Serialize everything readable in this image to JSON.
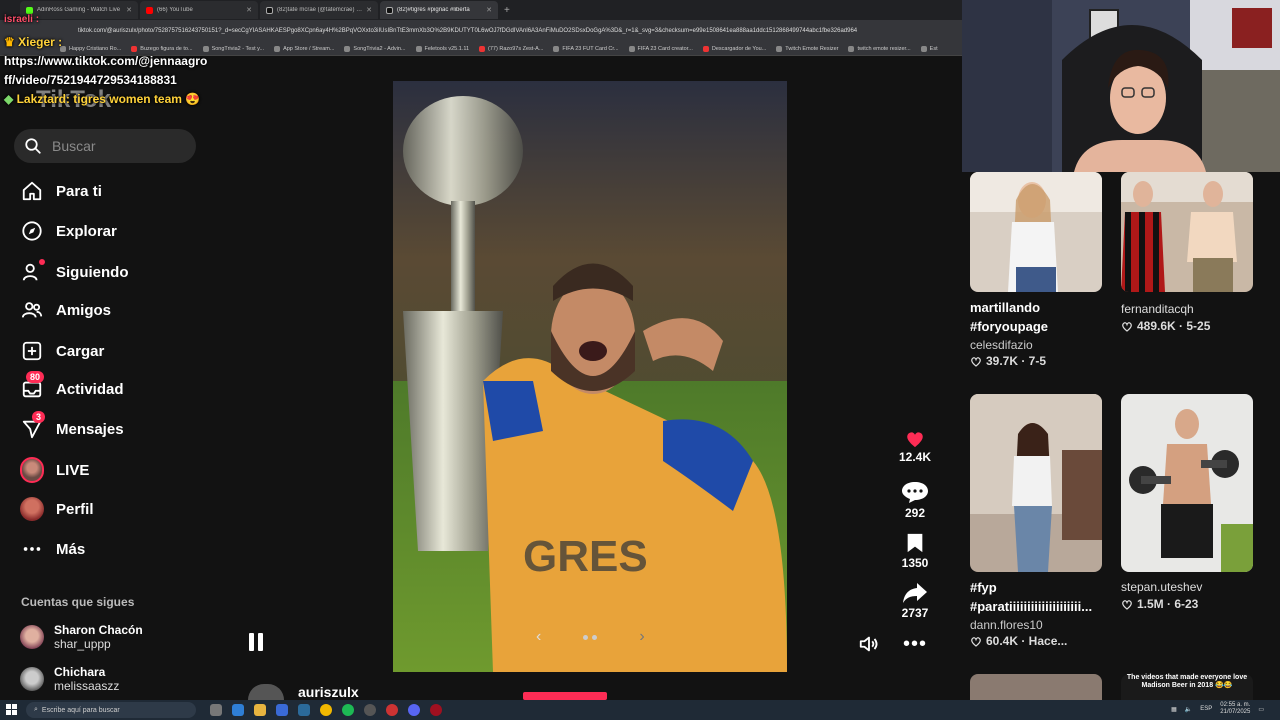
{
  "browser": {
    "tabs": [
      {
        "title": "AdinRoss Gaming - Watch Live",
        "color": "#53fc18",
        "active": false
      },
      {
        "title": "(66) YouTube",
        "color": "#ff0000",
        "active": false
      },
      {
        "title": "(82)tate mcrae (@tatemcrae) | T",
        "color": "#ffffff",
        "active": false
      },
      {
        "title": "(82)#tigres #pignac #liberta",
        "color": "#ffffff",
        "active": true
      }
    ],
    "url": "tiktok.com/@auriszulx/photo/7528757516243750151?_d=secCgYIASAHKAESPgo8XCpn6ay4H%2BPqVOXxto3iIUsIBnTtE3mmXb3O%2B9KDUTYT0L6wOJ7fDGdIVAnl6A3AnFiMuDO2SDsxDoGgA%3D&_r=1&_svg=3&checksum=e99e1508641ea888aa1ddc1512868499744abc1fbe326ad964",
    "bookmarks": [
      "Happy Cristiano Ro...",
      "Buzego figura de to...",
      "SongTrivia2 - Test y...",
      "App Store / Stream...",
      "SongTrivia2 - Advin...",
      "Feletools v25.1.11",
      "(77) Razo97s Zest-A...",
      "FIFA 23 FUT Card Cr...",
      "FIFA 23 Card creator...",
      "Descargador de You...",
      "Twitch Emote Resizer",
      "twitch emote resizer...",
      "Est"
    ]
  },
  "chat": {
    "line1": "israeli :",
    "line2": "Xieger :",
    "line3": "https://www.tiktok.com/@jennaagro",
    "line4": "ff/video/7521944729534188831",
    "line5": "Lakztard: tigres women team 😍"
  },
  "sidebar": {
    "logo": "TikTok",
    "search_placeholder": "Buscar",
    "nav": [
      {
        "label": "Para ti",
        "icon": "home-icon"
      },
      {
        "label": "Explorar",
        "icon": "compass-icon"
      },
      {
        "label": "Siguiendo",
        "icon": "following-icon"
      },
      {
        "label": "Amigos",
        "icon": "friends-icon"
      },
      {
        "label": "Cargar",
        "icon": "upload-icon"
      },
      {
        "label": "Actividad",
        "icon": "activity-icon",
        "badge": "80"
      },
      {
        "label": "Mensajes",
        "icon": "messages-icon",
        "badge": "3"
      },
      {
        "label": "LIVE",
        "icon": "live-icon"
      },
      {
        "label": "Perfil",
        "icon": "profile-icon"
      },
      {
        "label": "Más",
        "icon": "more-icon"
      }
    ],
    "following_title": "Cuentas que sigues",
    "following": [
      {
        "name": "Sharon Chacón",
        "handle": "shar_uppp"
      },
      {
        "name": "Chichara",
        "handle": "melissaaszz"
      }
    ]
  },
  "video": {
    "jersey_text": "GRES",
    "author": "auriszulx",
    "likes": "12.4K",
    "comments": "292",
    "saves": "1350",
    "shares": "2737"
  },
  "suggestions": [
    {
      "caption": "martillando #foryoupage",
      "user": "celesdifazio",
      "stats": "39.7K · 7-5"
    },
    {
      "caption": "",
      "user": "fernanditacqh",
      "stats": "489.6K · 5-25"
    },
    {
      "caption": "#fyp #paratiiiiiiiiiiiiiiiiiiii...",
      "user": "dann.flores10",
      "stats": "60.4K · Hace..."
    },
    {
      "caption": "",
      "user": "stepan.uteshev",
      "stats": "1.5M · 6-23"
    }
  ],
  "peek_caption": "The videos that made everyone love Madison Beer in 2018 😂😂",
  "taskbar": {
    "search_placeholder": "Escribe aquí para buscar",
    "time": "02:55 a. m.",
    "date": "21/07/2025",
    "lang": "ESP"
  },
  "colors": {
    "accent": "#fe2c55",
    "bg": "#121212"
  }
}
